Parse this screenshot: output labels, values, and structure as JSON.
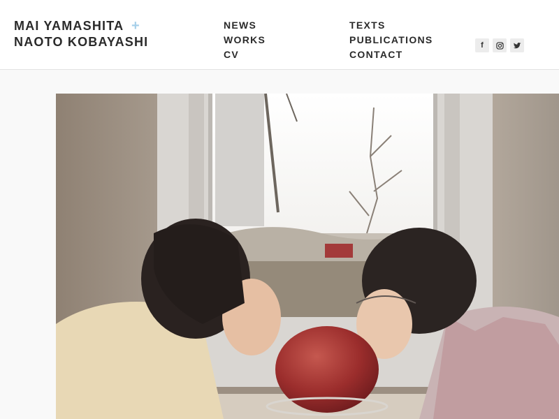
{
  "site": {
    "title_line1": "MAI YAMASHITA",
    "title_line2": "NAOTO KOBAYASHI",
    "plus_symbol": "+",
    "accent_color": "#a7d0ea"
  },
  "nav": {
    "column1": [
      {
        "label": "NEWS"
      },
      {
        "label": "WORKS"
      },
      {
        "label": "CV"
      }
    ],
    "column2": [
      {
        "label": "TEXTS"
      },
      {
        "label": "PUBLICATIONS"
      },
      {
        "label": "CONTACT"
      }
    ]
  },
  "social": [
    {
      "icon": "facebook-icon",
      "glyph": "f"
    },
    {
      "icon": "instagram-icon"
    },
    {
      "icon": "twitter-icon"
    }
  ]
}
